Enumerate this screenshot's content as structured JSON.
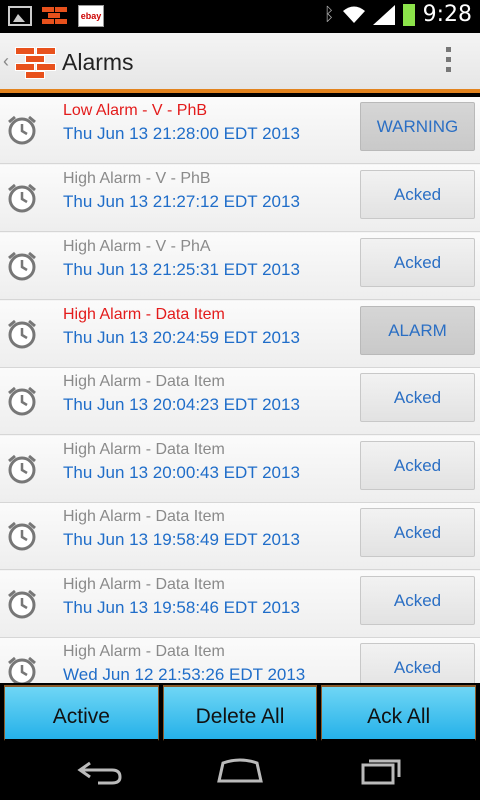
{
  "status_bar": {
    "time": "9:28",
    "icons": [
      "gallery-icon",
      "brick-app-icon",
      "ebay-icon",
      "bluetooth-icon",
      "wifi-icon",
      "signal-icon",
      "battery-icon"
    ]
  },
  "action_bar": {
    "title": "Alarms",
    "accent_color": "#e2831e"
  },
  "alarms": [
    {
      "title": "Low Alarm - V - PhB",
      "time": "Thu Jun 13 21:28:00 EDT 2013",
      "state": "active",
      "button": "WARNING"
    },
    {
      "title": "High Alarm - V - PhB",
      "time": "Thu Jun 13 21:27:12 EDT 2013",
      "state": "acked",
      "button": "Acked"
    },
    {
      "title": "High Alarm - V - PhA",
      "time": "Thu Jun 13 21:25:31 EDT 2013",
      "state": "acked",
      "button": "Acked"
    },
    {
      "title": "High Alarm - Data Item",
      "time": "Thu Jun 13 20:24:59 EDT 2013",
      "state": "active",
      "button": "ALARM"
    },
    {
      "title": "High Alarm - Data Item",
      "time": "Thu Jun 13 20:04:23 EDT 2013",
      "state": "acked",
      "button": "Acked"
    },
    {
      "title": "High Alarm - Data Item",
      "time": "Thu Jun 13 20:00:43 EDT 2013",
      "state": "acked",
      "button": "Acked"
    },
    {
      "title": "High Alarm - Data Item",
      "time": "Thu Jun 13 19:58:49 EDT 2013",
      "state": "acked",
      "button": "Acked"
    },
    {
      "title": "High Alarm - Data Item",
      "time": "Thu Jun 13 19:58:46 EDT 2013",
      "state": "acked",
      "button": "Acked"
    },
    {
      "title": "High Alarm - Data Item",
      "time": "Wed Jun 12 21:53:26 EDT 2013",
      "state": "acked",
      "button": "Acked"
    }
  ],
  "toolbar": {
    "active_label": "Active",
    "delete_all_label": "Delete All",
    "ack_all_label": "Ack All"
  },
  "colors": {
    "active_title": "#e31b1b",
    "acked_title": "#8a8a8a",
    "timestamp": "#1f6dc9",
    "toolbar_button": "#25b1e9"
  }
}
